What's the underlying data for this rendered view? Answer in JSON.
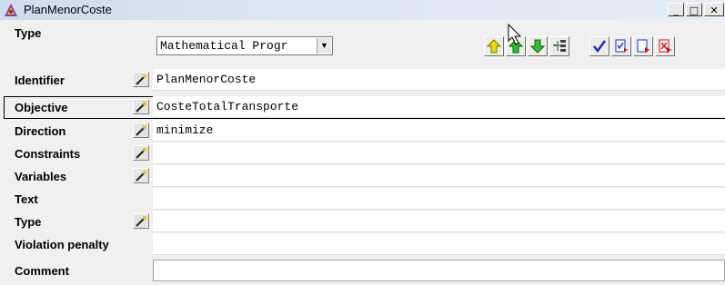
{
  "window": {
    "title": "PlanMenorCoste",
    "controls": [
      "_",
      "□",
      "✕"
    ]
  },
  "toolbar": {
    "type_label": "Type",
    "type_value": "Mathematical Progr",
    "buttons": [
      {
        "name": "move-up-icon",
        "color": "#e8d000"
      },
      {
        "name": "move-up-green-icon",
        "color": "#1aa01a"
      },
      {
        "name": "move-down-icon",
        "color": "#1aa01a"
      },
      {
        "name": "tree-icon",
        "color": "#404040"
      },
      {
        "name": "check-icon",
        "color": "#1030d0"
      },
      {
        "name": "check-document-icon",
        "color": "#1030d0"
      },
      {
        "name": "export-icon",
        "color": "#1030d0"
      },
      {
        "name": "cancel-document-icon",
        "color": "#d01010"
      }
    ]
  },
  "attributes": [
    {
      "label": "Identifier",
      "value": "PlanMenorCoste",
      "editable": true
    },
    {
      "label": "Objective",
      "value": "CosteTotalTransporte",
      "editable": true,
      "selected": true
    },
    {
      "label": "Direction",
      "value": "minimize",
      "editable": true
    },
    {
      "label": "Constraints",
      "value": "",
      "editable": true
    },
    {
      "label": "Variables",
      "value": "",
      "editable": true
    },
    {
      "label": "Text",
      "value": "",
      "editable": false
    },
    {
      "label": "Type",
      "value": "",
      "editable": true
    },
    {
      "label": "Violation penalty",
      "value": "",
      "editable": false
    },
    {
      "label": "Comment",
      "value": "",
      "editable": false
    }
  ]
}
